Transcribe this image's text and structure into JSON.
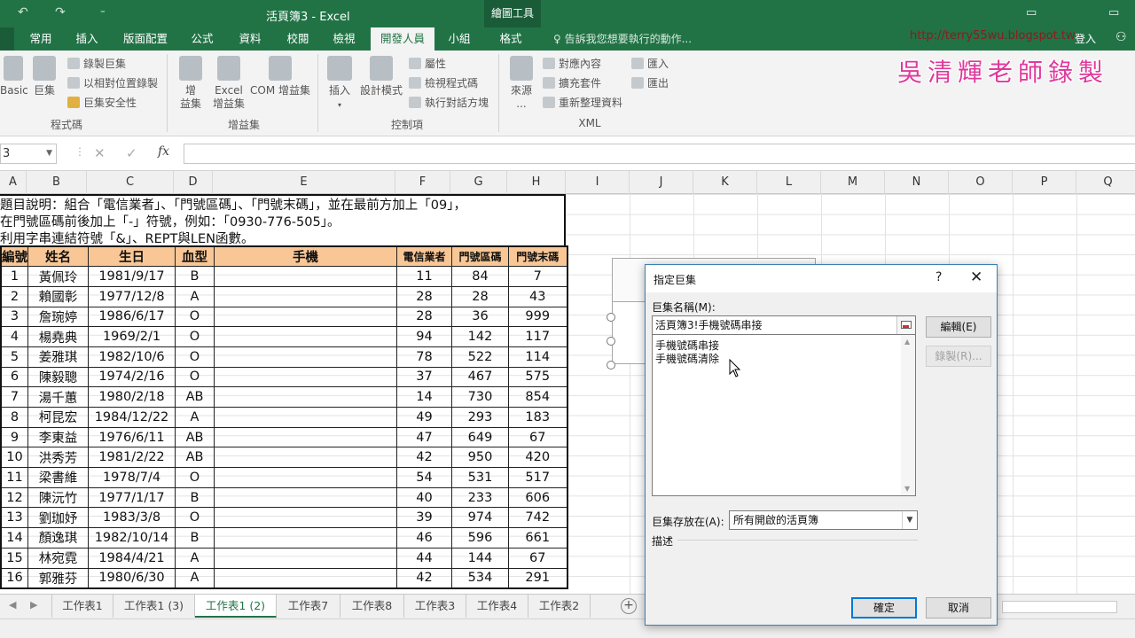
{
  "titlebar": {
    "undo_icon": "↶",
    "redo_icon": "↷",
    "qat_more": "⁼",
    "title": "活頁簿3 - Excel",
    "context_tab": "繪圖工具",
    "restore_icon": "▭"
  },
  "tabs": {
    "items": [
      "常用",
      "插入",
      "版面配置",
      "公式",
      "資料",
      "校閱",
      "檢視",
      "開發人員",
      "小組",
      "格式"
    ],
    "active": "開發人員",
    "tell_me": "告訴我您想要執行的動作...",
    "login": "登入"
  },
  "watermark": {
    "url": "http://terry55wu.blogspot.tw",
    "text": "吳清輝老師錄製"
  },
  "ribbon": {
    "basic_label": "Basic",
    "macro_label": "巨集",
    "record_macro": "錄製巨集",
    "relative_ref": "以相對位置錄製",
    "macro_security": "巨集安全性",
    "group_code": "程式碼",
    "addins_label_1": "增",
    "addins_label_2": "益集",
    "excel_addins_1": "Excel",
    "excel_addins_2": "增益集",
    "com_addins": "COM 增益集",
    "group_addins": "增益集",
    "insert_label": "插入",
    "design_mode": "設計模式",
    "properties": "屬性",
    "view_code": "檢視程式碼",
    "run_dialog": "執行對話方塊",
    "group_controls": "控制項",
    "source_1": "來源",
    "source_2": "...",
    "map_properties": "對應內容",
    "expansion_packs": "擴充套件",
    "refresh_data": "重新整理資料",
    "group_xml": "XML",
    "import": "匯入",
    "export": "匯出"
  },
  "formula_bar": {
    "name_box": "3",
    "cancel_icon": "✕",
    "enter_icon": "✓",
    "fx": "fx",
    "formula": ""
  },
  "columns": [
    "A",
    "B",
    "C",
    "D",
    "E",
    "F",
    "G",
    "H",
    "I",
    "J",
    "K",
    "L",
    "M",
    "N",
    "O",
    "P",
    "Q"
  ],
  "notes": [
    "題目說明：組合「電信業者」、「門號區碼」、「門號末碼」，並在最前方加上「09」，",
    "在門號區碼前後加上「-」符號，例如：「0930-776-505」。",
    "利用字串連結符號「&」、REPT與LEN函數。"
  ],
  "table": {
    "headers": [
      "編號",
      "姓名",
      "生日",
      "血型",
      "手機",
      "電信業者",
      "門號區碼",
      "門號末碼"
    ],
    "rows": [
      [
        "1",
        "黃佩玲",
        "1981/9/17",
        "B",
        "",
        "11",
        "84",
        "7"
      ],
      [
        "2",
        "賴國彰",
        "1977/12/8",
        "A",
        "",
        "28",
        "28",
        "43"
      ],
      [
        "3",
        "詹琬婷",
        "1986/6/17",
        "O",
        "",
        "28",
        "36",
        "999"
      ],
      [
        "4",
        "楊堯典",
        "1969/2/1",
        "O",
        "",
        "94",
        "142",
        "117"
      ],
      [
        "5",
        "姜雅琪",
        "1982/10/6",
        "O",
        "",
        "78",
        "522",
        "114"
      ],
      [
        "6",
        "陳毅聰",
        "1974/2/16",
        "O",
        "",
        "37",
        "467",
        "575"
      ],
      [
        "7",
        "湯千蕙",
        "1980/2/18",
        "AB",
        "",
        "14",
        "730",
        "854"
      ],
      [
        "8",
        "柯昆宏",
        "1984/12/22",
        "A",
        "",
        "49",
        "293",
        "183"
      ],
      [
        "9",
        "李東益",
        "1976/6/11",
        "AB",
        "",
        "47",
        "649",
        "67"
      ],
      [
        "10",
        "洪秀芳",
        "1981/2/22",
        "AB",
        "",
        "42",
        "950",
        "420"
      ],
      [
        "11",
        "梁書維",
        "1978/7/4",
        "O",
        "",
        "54",
        "531",
        "517"
      ],
      [
        "12",
        "陳沅竹",
        "1977/1/17",
        "B",
        "",
        "40",
        "233",
        "606"
      ],
      [
        "13",
        "劉珈妤",
        "1983/3/8",
        "O",
        "",
        "39",
        "974",
        "742"
      ],
      [
        "14",
        "顏逸琪",
        "1982/10/14",
        "B",
        "",
        "46",
        "596",
        "661"
      ],
      [
        "15",
        "林宛霓",
        "1984/4/21",
        "A",
        "",
        "44",
        "144",
        "67"
      ],
      [
        "16",
        "郭雅芬",
        "1980/6/30",
        "A",
        "",
        "42",
        "534",
        "291"
      ]
    ]
  },
  "sheet_tabs": {
    "items": [
      "工作表1",
      "工作表1 (3)",
      "工作表1 (2)",
      "工作表7",
      "工作表8",
      "工作表3",
      "工作表4",
      "工作表2"
    ],
    "active": "工作表1 (2)",
    "add": "+"
  },
  "dialog": {
    "title": "指定巨集",
    "help": "?",
    "close": "✕",
    "name_label": "巨集名稱(M):",
    "name_value": "活頁簿3!手機號碼串接",
    "list": [
      "手機號碼串接",
      "手機號碼清除"
    ],
    "edit_button": "編輯(E)",
    "record_button": "錄製(R)...",
    "macros_in_label": "巨集存放在(A):",
    "macros_in_value": "所有開啟的活頁簿",
    "description_label": "描述",
    "ok_button": "確定",
    "cancel_button": "取消"
  },
  "colors": {
    "excel_green": "#217346",
    "header_fill": "#f9c796",
    "watermark": "#e0399c"
  }
}
